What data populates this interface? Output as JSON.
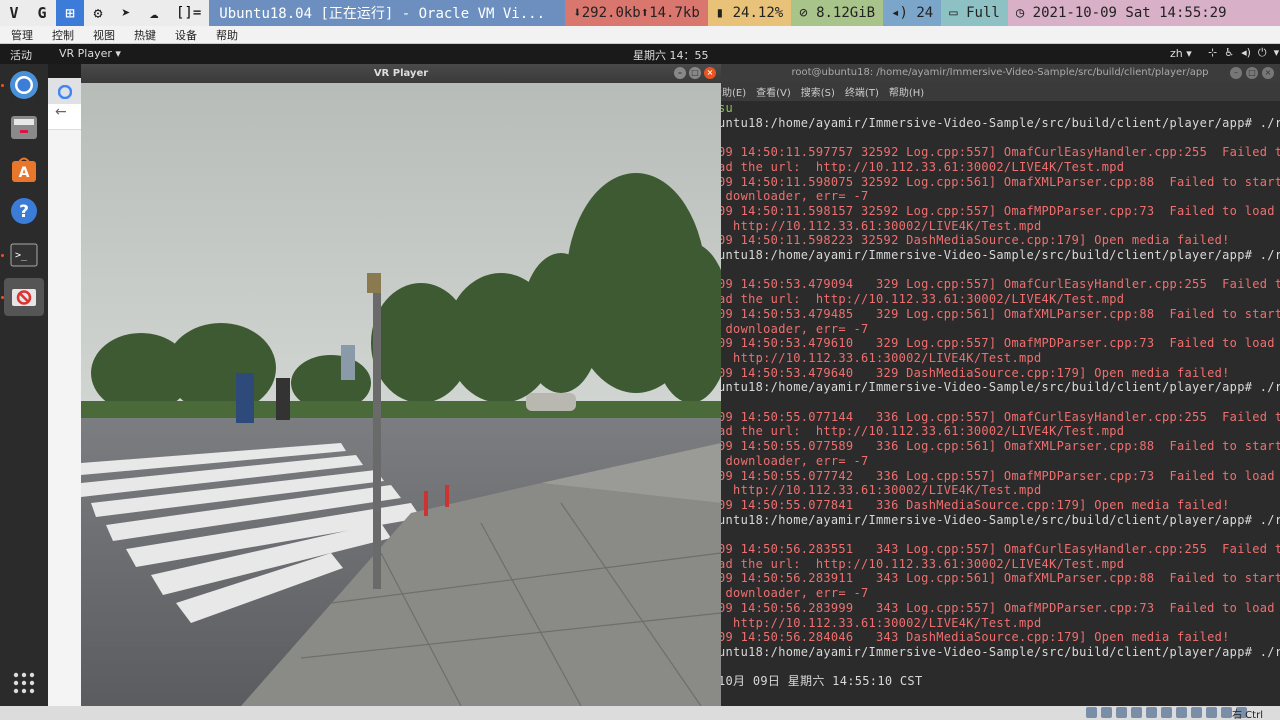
{
  "hostbar": {
    "window_title": "Ubuntu18.04 [正在运行] - Oracle VM Vi...",
    "net_down": "292.0kb",
    "net_up": "14.7kb",
    "battery": "24.12%",
    "memory": "8.12GiB",
    "volume": "24",
    "display": "Full",
    "datetime": "2021-10-09 Sat 14:55:29",
    "layout_indicator": "[]="
  },
  "vm_menu": [
    "管理",
    "控制",
    "视图",
    "热键",
    "设备",
    "帮助"
  ],
  "gnome": {
    "activities": "活动",
    "app_menu": "VR Player ▾",
    "clock": "星期六 14：55",
    "lang": "zh ▾"
  },
  "dock": {
    "items": [
      "chrome-icon",
      "files-icon",
      "software-center-icon",
      "help-icon",
      "terminal-icon",
      "vr-player-icon"
    ],
    "apps_grid": "show-applications-icon"
  },
  "vr_window": {
    "title": "VR Player"
  },
  "terminal": {
    "title": "root@ubuntu18: /home/ayamir/Immersive-Video-Sample/src/build/client/player/app",
    "menu": [
      "帮助(E)",
      "查看(V)",
      "搜索(S)",
      "终端(T)",
      "帮助(H)"
    ],
    "lines": [
      {
        "t": "su",
        "c": "green"
      },
      {
        "t": "untu18:/home/ayamir/Immersive-Video-Sample/src/build/client/player/app# ./re",
        "c": "prompt"
      },
      {
        "t": "",
        "c": "prompt"
      },
      {
        "t": "09 14:50:11.597757 32592 Log.cpp:557] OmafCurlEasyHandler.cpp:255  Failed to",
        "c": "err"
      },
      {
        "t": "ad the url:  http://10.112.33.61:30002/LIVE4K/Test.mpd",
        "c": "err"
      },
      {
        "t": "09 14:50:11.598075 32592 Log.cpp:561] OmafXMLParser.cpp:88  Failed to start",
        "c": "err"
      },
      {
        "t": " downloader, err= -7",
        "c": "err"
      },
      {
        "t": "09 14:50:11.598157 32592 Log.cpp:557] OmafMPDParser.cpp:73  Failed to load M",
        "c": "err"
      },
      {
        "t": "  http://10.112.33.61:30002/LIVE4K/Test.mpd",
        "c": "err"
      },
      {
        "t": "09 14:50:11.598223 32592 DashMediaSource.cpp:179] Open media failed!",
        "c": "err"
      },
      {
        "t": "untu18:/home/ayamir/Immersive-Video-Sample/src/build/client/player/app# ./re",
        "c": "prompt"
      },
      {
        "t": "",
        "c": "prompt"
      },
      {
        "t": "09 14:50:53.479094   329 Log.cpp:557] OmafCurlEasyHandler.cpp:255  Failed to",
        "c": "err"
      },
      {
        "t": "ad the url:  http://10.112.33.61:30002/LIVE4K/Test.mpd",
        "c": "err"
      },
      {
        "t": "09 14:50:53.479485   329 Log.cpp:561] OmafXMLParser.cpp:88  Failed to start",
        "c": "err"
      },
      {
        "t": " downloader, err= -7",
        "c": "err"
      },
      {
        "t": "09 14:50:53.479610   329 Log.cpp:557] OmafMPDParser.cpp:73  Failed to load M",
        "c": "err"
      },
      {
        "t": "  http://10.112.33.61:30002/LIVE4K/Test.mpd",
        "c": "err"
      },
      {
        "t": "09 14:50:53.479640   329 DashMediaSource.cpp:179] Open media failed!",
        "c": "err"
      },
      {
        "t": "untu18:/home/ayamir/Immersive-Video-Sample/src/build/client/player/app# ./re",
        "c": "prompt"
      },
      {
        "t": "",
        "c": "prompt"
      },
      {
        "t": "09 14:50:55.077144   336 Log.cpp:557] OmafCurlEasyHandler.cpp:255  Failed to",
        "c": "err"
      },
      {
        "t": "ad the url:  http://10.112.33.61:30002/LIVE4K/Test.mpd",
        "c": "err"
      },
      {
        "t": "09 14:50:55.077589   336 Log.cpp:561] OmafXMLParser.cpp:88  Failed to start",
        "c": "err"
      },
      {
        "t": " downloader, err= -7",
        "c": "err"
      },
      {
        "t": "09 14:50:55.077742   336 Log.cpp:557] OmafMPDParser.cpp:73  Failed to load M",
        "c": "err"
      },
      {
        "t": "  http://10.112.33.61:30002/LIVE4K/Test.mpd",
        "c": "err"
      },
      {
        "t": "09 14:50:55.077841   336 DashMediaSource.cpp:179] Open media failed!",
        "c": "err"
      },
      {
        "t": "untu18:/home/ayamir/Immersive-Video-Sample/src/build/client/player/app# ./re",
        "c": "prompt"
      },
      {
        "t": "",
        "c": "prompt"
      },
      {
        "t": "09 14:50:56.283551   343 Log.cpp:557] OmafCurlEasyHandler.cpp:255  Failed to",
        "c": "err"
      },
      {
        "t": "ad the url:  http://10.112.33.61:30002/LIVE4K/Test.mpd",
        "c": "err"
      },
      {
        "t": "09 14:50:56.283911   343 Log.cpp:561] OmafXMLParser.cpp:88  Failed to start",
        "c": "err"
      },
      {
        "t": " downloader, err= -7",
        "c": "err"
      },
      {
        "t": "09 14:50:56.283999   343 Log.cpp:557] OmafMPDParser.cpp:73  Failed to load M",
        "c": "err"
      },
      {
        "t": "  http://10.112.33.61:30002/LIVE4K/Test.mpd",
        "c": "err"
      },
      {
        "t": "09 14:50:56.284046   343 DashMediaSource.cpp:179] Open media failed!",
        "c": "err"
      },
      {
        "t": "untu18:/home/ayamir/Immersive-Video-Sample/src/build/client/player/app# ./re",
        "c": "prompt"
      },
      {
        "t": "",
        "c": "prompt"
      },
      {
        "t": "10月 09日 星期六 14:55:10 CST",
        "c": "prompt"
      }
    ]
  },
  "statusbar": {
    "host_key": "右 Ctrl"
  },
  "colors": {
    "error_text": "#ef6f6f",
    "terminal_bg": "#2b2b2b",
    "accent": "#e95420"
  }
}
